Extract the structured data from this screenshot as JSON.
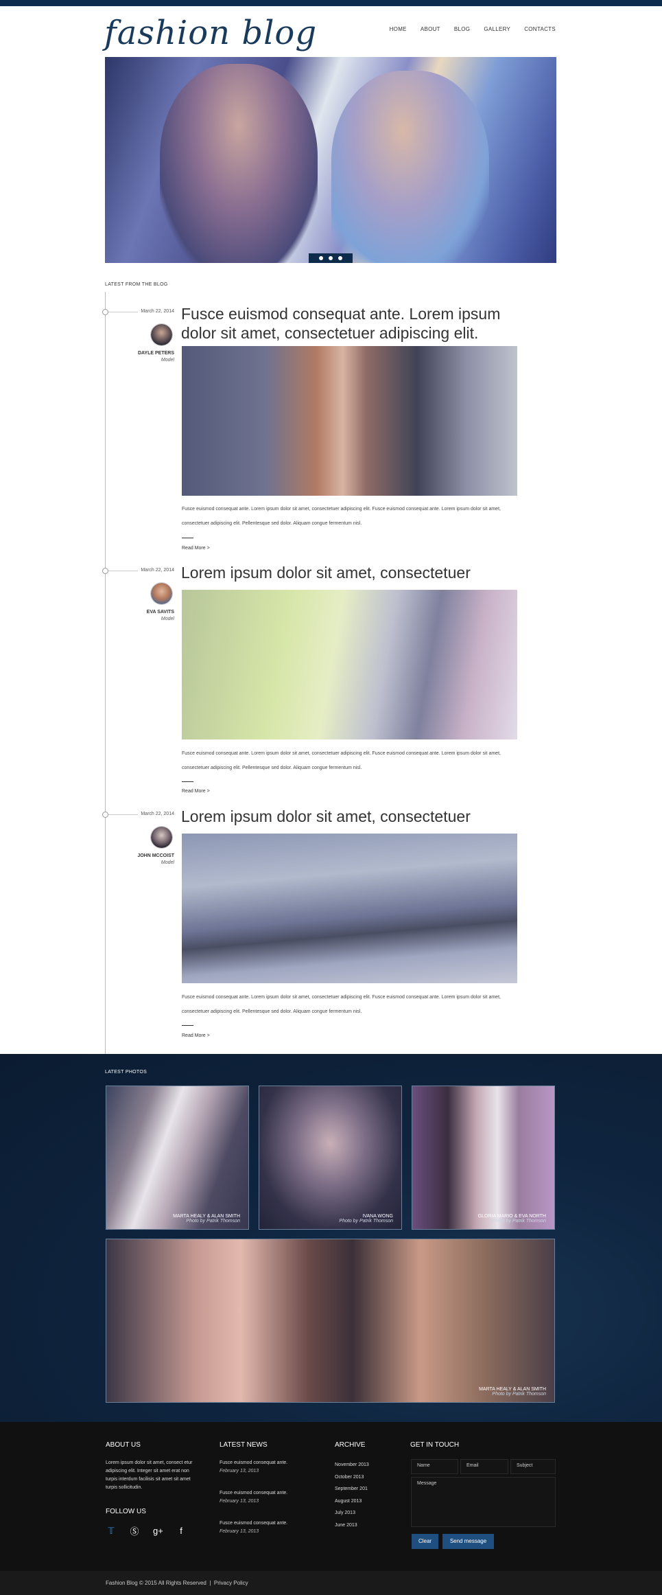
{
  "header": {
    "logo": "fashion blog",
    "nav": [
      "HOME",
      "ABOUT",
      "BLOG",
      "GALLERY",
      "CONTACTS"
    ]
  },
  "blog": {
    "label": "LATEST FROM THE BLOG",
    "posts": [
      {
        "date": "March 22, 2014",
        "author": "DAYLE PETERS",
        "role": "Model",
        "title": "Fusce euismod consequat ante. Lorem ipsum dolor sit amet, consectetuer adipiscing elit.",
        "text": "Fusce euismod consequat ante. Lorem ipsum dolor sit amet, consectetuer adipiscing elit. Fusce euismod consequat ante. Lorem ipsum dolor sit amet, consectetuer adipiscing elit. Pellentesque sed dolor. Aliquam congue fermentum nisl.",
        "read_more": "Read More >"
      },
      {
        "date": "March 22, 2014",
        "author": "EVA SAVITS",
        "role": "Model",
        "title": "Lorem ipsum dolor sit amet, consectetuer",
        "text": "Fusce euismod consequat ante. Lorem ipsum dolor sit amet, consectetuer adipiscing elit. Fusce euismod consequat ante. Lorem ipsum dolor sit amet, consectetuer adipiscing elit. Pellentesque sed dolor. Aliquam congue fermentum nisl.",
        "read_more": "Read More >"
      },
      {
        "date": "March 22, 2014",
        "author": "JOHN MCCOIST",
        "role": "Model",
        "title": "Lorem ipsum dolor sit amet, consectetuer",
        "text": "Fusce euismod consequat ante. Lorem ipsum dolor sit amet, consectetuer adipiscing elit. Fusce euismod consequat ante. Lorem ipsum dolor sit amet, consectetuer adipiscing elit. Pellentesque sed dolor. Aliquam congue fermentum nisl.",
        "read_more": "Read More >"
      }
    ]
  },
  "photos": {
    "label": "LATEST PHOTOS",
    "items": [
      {
        "name": "MARTA HEALY & ALAN SMITH",
        "credit": "Photo by Patrik Thomson"
      },
      {
        "name": "IVANA WONG",
        "credit": "Photo by Patrik Thomson"
      },
      {
        "name": "GLORIA MARIO & EVA NORTH",
        "credit": "Photo by Patrik Thomson"
      },
      {
        "name": "MARTA HEALY & ALAN SMITH",
        "credit": "Photo by Patrik Thomson"
      }
    ]
  },
  "footer": {
    "about_head": "ABOUT US",
    "about_text": "Lorem ipsum dolor sit amet, consect etur adipiscing elit. Integer sit amet erat non turpis interdum facilisis sit amet sit amet turpis sollicitudin.",
    "follow_head": "FOLLOW US",
    "social": [
      "twitter-icon",
      "skype-icon",
      "google-plus-icon",
      "facebook-icon"
    ],
    "news_head": "LATEST NEWS",
    "news": [
      {
        "title": "Fusce euismod consequat ante.",
        "date": "February 13, 2013"
      },
      {
        "title": "Fusce euismod consequat ante.",
        "date": "February 13, 2013"
      },
      {
        "title": "Fusce euismod consequat ante.",
        "date": "February 13, 2013"
      }
    ],
    "archive_head": "ARCHIVE",
    "archive": [
      "November 2013",
      "October 2013",
      "September 201",
      "August 2013",
      "July 2013",
      "June 2013"
    ],
    "contact_head": "GET IN TOUCH",
    "name_placeholder": "Name",
    "email_placeholder": "Email",
    "subject_placeholder": "Subject",
    "message_placeholder": "Message",
    "clear_label": "Clear",
    "send_label": "Send message"
  },
  "bottom": {
    "copyright": "Fashion Blog © 2015 All Rights Reserved",
    "separator": "|",
    "privacy": "Privacy Policy"
  },
  "colors": {
    "brand_dark": "#0d2b4a",
    "button": "#1f4f80",
    "footer_bg": "#111111"
  }
}
